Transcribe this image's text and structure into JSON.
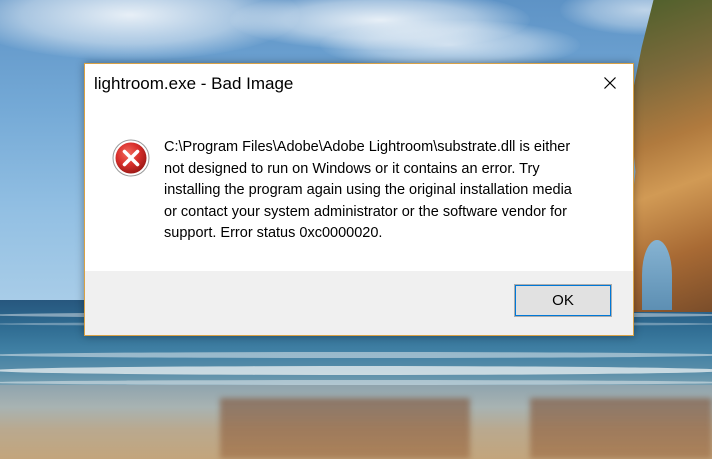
{
  "dialog": {
    "title": "lightroom.exe - Bad Image",
    "icon": "error-icon",
    "message_lines": [
      "C:\\Program Files\\Adobe\\Adobe Lightroom\\substrate.dll is either",
      "not designed to run on Windows or it contains an error. Try",
      "installing the program again using the original installation media",
      "or contact your system administrator or the software vendor for",
      "support. Error status 0xc0000020."
    ],
    "close_icon": "close-icon",
    "ok_label": "OK"
  },
  "colors": {
    "dialog_border": "#d8a146",
    "error_red": "#d9302c",
    "footer_bg": "#f0f0f0",
    "button_focus": "#0078d7"
  }
}
